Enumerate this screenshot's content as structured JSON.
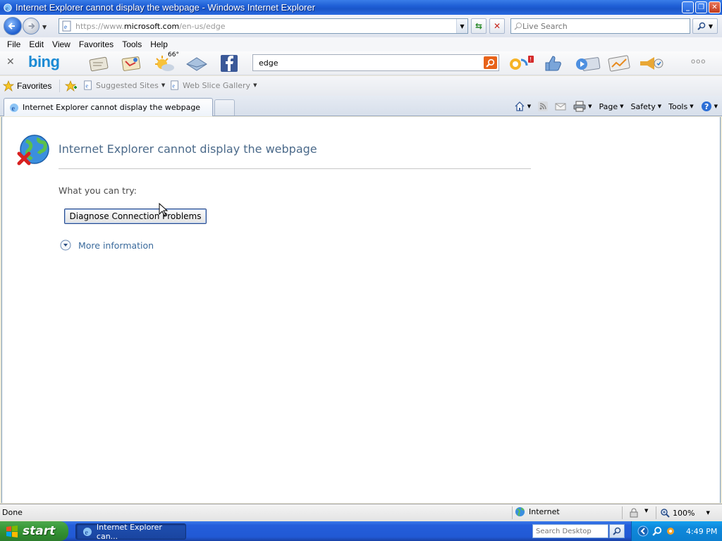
{
  "window": {
    "title": "Internet Explorer cannot display the webpage - Windows Internet Explorer",
    "controls": [
      "_",
      "❐",
      "✕"
    ]
  },
  "address": {
    "url_prefix": "https://www.",
    "url_host": "microsoft.com",
    "url_path": "/en-us/edge"
  },
  "search": {
    "placeholder": "Live Search"
  },
  "menu": [
    "File",
    "Edit",
    "View",
    "Favorites",
    "Tools",
    "Help"
  ],
  "bing_toolbar": {
    "logo": "bing",
    "weather_temp": "66°",
    "search_value": "edge",
    "more": "ooo"
  },
  "favorites_bar": {
    "favorites_label": "Favorites",
    "links": [
      "Suggested Sites",
      "Web Slice Gallery"
    ]
  },
  "tab": {
    "label": "Internet Explorer cannot display the webpage"
  },
  "command_bar": {
    "page": "Page",
    "safety": "Safety",
    "tools": "Tools"
  },
  "content": {
    "title": "Internet Explorer cannot display the webpage",
    "try_label": "What you can try:",
    "diagnose_button": "Diagnose Connection Problems",
    "more_info": "More information"
  },
  "status": {
    "text": "Done",
    "zone": "Internet",
    "zoom": "100%"
  },
  "taskbar": {
    "start": "start",
    "task_item": "Internet Explorer can...",
    "search_placeholder": "Search Desktop",
    "clock": "4:49 PM"
  },
  "colors": {
    "titlebar": "#1f5fd6",
    "taskbar": "#245edb",
    "start": "#3b9b3b",
    "error_title": "#4b6a8a",
    "link": "#3a6a9c"
  }
}
